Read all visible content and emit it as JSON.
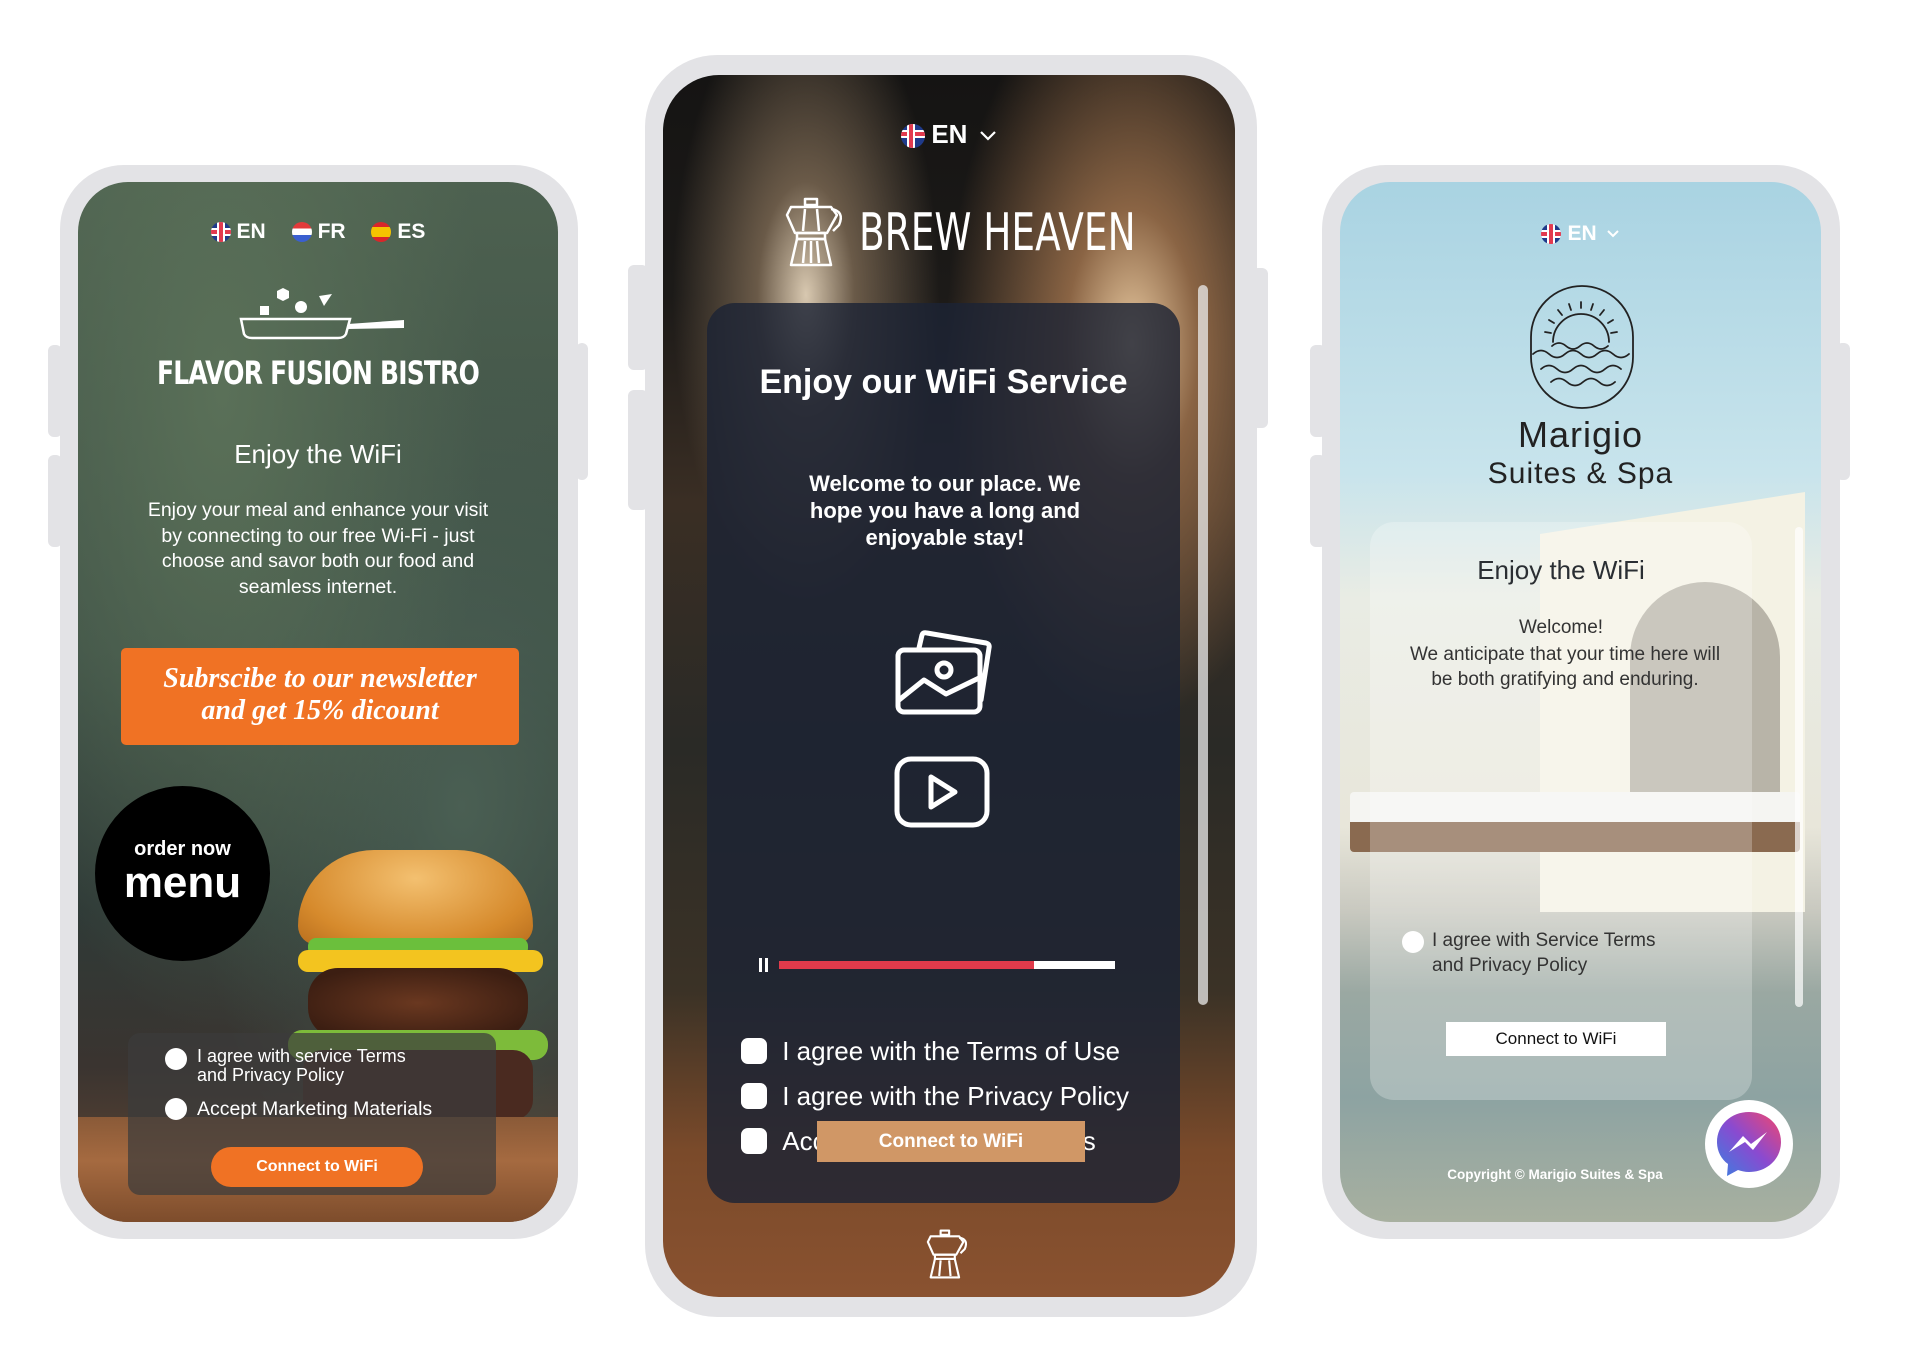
{
  "phones": {
    "bistro": {
      "languages": [
        {
          "code": "EN",
          "flag": "uk-flag"
        },
        {
          "code": "FR",
          "flag": "fr-flag"
        },
        {
          "code": "ES",
          "flag": "es-flag"
        }
      ],
      "logo_icon": "frying-pan-icon",
      "brand_name": "FLAVOR FUSION BISTRO",
      "heading": "Enjoy the WiFi",
      "description": "Enjoy your meal and enhance your visit by connecting to our free Wi-Fi - just choose and savor both our food and seamless internet.",
      "newsletter_banner": {
        "line1": "Subrscibe to our newsletter",
        "line2": "and get 15% dicount"
      },
      "order_badge": {
        "small": "order now",
        "big": "menu"
      },
      "hero_image": "burger-image",
      "consents": [
        {
          "label": "I agree with service Terms and Privacy Policy",
          "checked": false
        },
        {
          "label": "Accept Marketing Materials",
          "checked": false
        }
      ],
      "connect_button": "Connect to WiFi",
      "colors": {
        "accent": "#f07224",
        "card": "#3c3c3c"
      }
    },
    "brew": {
      "language": {
        "code": "EN",
        "flag": "uk-flag",
        "icon": "chevron-down-icon"
      },
      "logo_icon": "moka-pot-icon",
      "brand_name": "BREW HEAVEN",
      "heading": "Enjoy our WiFi Service",
      "welcome": "Welcome to our place. We hope you have a long and enjoyable stay!",
      "media_icons": [
        "image-gallery-icon",
        "video-play-icon"
      ],
      "video": {
        "state": "paused",
        "progress_percent": 76
      },
      "consents": [
        {
          "label": "I agree with the Terms of Use",
          "checked": false
        },
        {
          "label": "I agree with the Privacy Policy",
          "checked": false
        },
        {
          "label": "Accept Marketing Materials",
          "checked": false
        }
      ],
      "connect_button": "Connect to WiFi",
      "footer_icon": "moka-pot-icon",
      "colors": {
        "accent": "#d09766",
        "progress": "#e03a4b",
        "card": "#1e2535"
      }
    },
    "marigio": {
      "language": {
        "code": "EN",
        "flag": "uk-flag",
        "icon": "chevron-down-icon"
      },
      "logo_icon": "sun-waves-icon",
      "brand_name": "Marigio",
      "brand_sub": "Suites & Spa",
      "heading": "Enjoy the WiFi",
      "welcome_title": "Welcome!",
      "welcome_text": "We anticipate that your time here will be both gratifying and enduring.",
      "consents": [
        {
          "label": "I agree with Service Terms and Privacy Policy",
          "checked": false
        }
      ],
      "connect_button": "Connect to WiFi",
      "chat_icon": "messenger-icon",
      "copyright": "Copyright © Marigio Suites & Spa"
    }
  }
}
